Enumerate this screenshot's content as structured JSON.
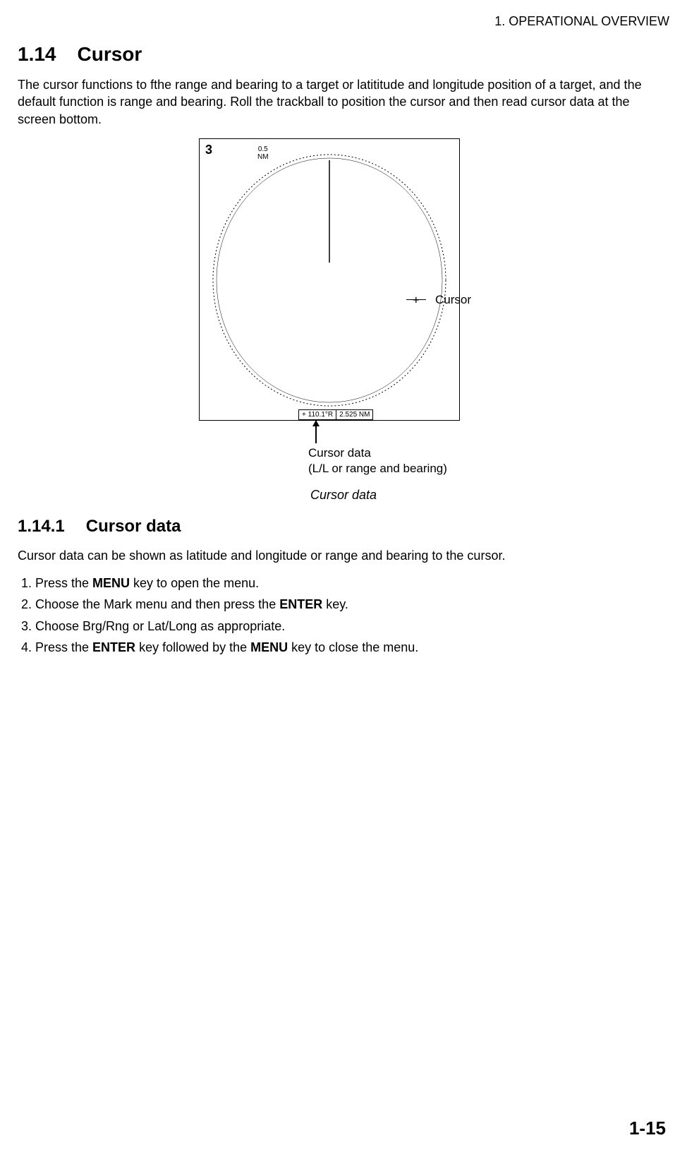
{
  "header": "1. OPERATIONAL OVERVIEW",
  "section": {
    "number": "1.14",
    "title": "Cursor"
  },
  "intro_paragraph": "The cursor functions to fthe range and bearing to a target or latititude and longitude position of a target, and the default function is range and bearing. Roll the trackball to position the cursor and then read cursor data at the screen bottom.",
  "figure": {
    "range_number": "3",
    "range_value": "0.5",
    "range_unit": "NM",
    "cursor_mark": "+",
    "cursor_label": "Cursor",
    "readout_bearing": "+ 110.1°R",
    "readout_range": "2.525 NM",
    "below_label_line1": "Cursor data",
    "below_label_line2": "(L/L or range and bearing)",
    "caption": "Cursor data"
  },
  "subsection": {
    "number": "1.14.1",
    "title": "Cursor data"
  },
  "subsection_paragraph": "Cursor data can be shown as latitude and longitude or range and bearing to the cursor.",
  "steps": {
    "s1a": "Press the ",
    "s1b": "MENU",
    "s1c": " key to open the menu.",
    "s2a": "Choose the Mark menu and then press the ",
    "s2b": "ENTER",
    "s2c": " key.",
    "s3": "Choose Brg/Rng or Lat/Long as appropriate.",
    "s4a": "Press the ",
    "s4b": "ENTER",
    "s4c": " key followed by the ",
    "s4d": "MENU",
    "s4e": " key to close the menu."
  },
  "page_number": "1-15"
}
